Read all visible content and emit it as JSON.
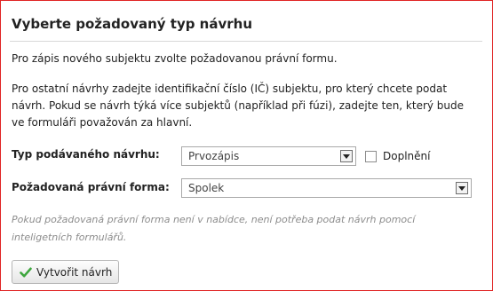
{
  "header": {
    "title": "Vyberte požadovaný typ návrhu"
  },
  "intro": {
    "paragraph1": "Pro zápis nového subjektu zvolte požadovanou právní formu.",
    "paragraph2": [
      "Pro ostatní návrhy zadejte identifikační číslo (IČ) subjektu, pro který chcete podat",
      "návrh. Pokud se návrh týká více subjektů (například při fúzi), zadejte ten, který bude",
      "ve formuláři považován za hlavní."
    ]
  },
  "form": {
    "typ_label": "Typ podávaného návrhu:",
    "typ_value": "Prvozápis",
    "doplneni_label": "Doplnění",
    "doplneni_checked": false,
    "forma_label": "Požadovaná právní forma:",
    "forma_value": "Spolek",
    "note": [
      "Pokud požadovaná právní forma není v nabídce, není potřeba podat návrh pomocí",
      "inteligetních formulářů."
    ]
  },
  "actions": {
    "create_label": "Vytvořit návrh",
    "create_icon": "check-icon",
    "icon_color": "#3da63d"
  },
  "colors": {
    "panel_border": "#e02424",
    "note_text": "#8c8c8c"
  }
}
